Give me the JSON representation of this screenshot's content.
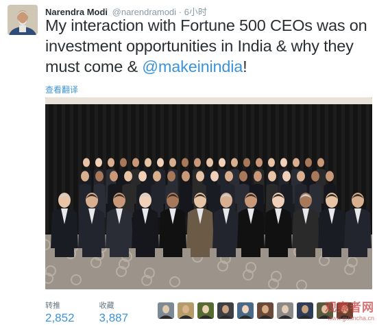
{
  "tweet": {
    "author_name": "Narendra Modi",
    "author_handle": "@narendramodi",
    "separator": "·",
    "timestamp": "6小时",
    "text_before": "My interaction with Fortune 500 CEOs was on investment opportunities in India & why they must come & ",
    "mention": "@makeinindia",
    "text_after": "!",
    "translate_link": "查看翻译"
  },
  "stats": {
    "retweets_label": "转推",
    "retweets_value": "2,852",
    "likes_label": "收藏",
    "likes_value": "3,887"
  },
  "watermark": {
    "main": "观察者网",
    "sub": "www.guancha.cn"
  },
  "colors": {
    "link": "#3b94d9",
    "text": "#292f33",
    "muted": "#8899a6"
  }
}
